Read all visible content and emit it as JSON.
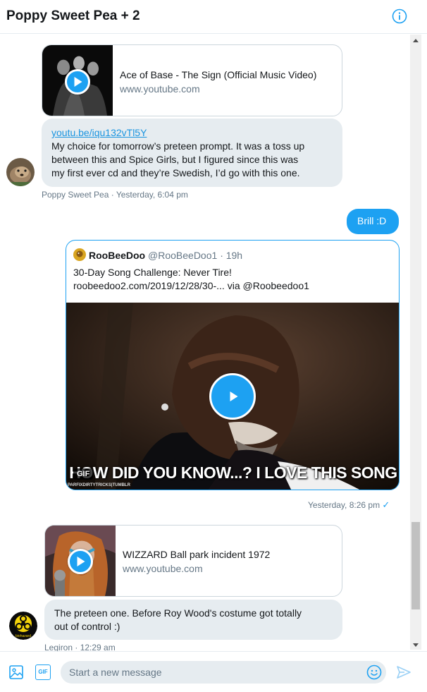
{
  "header": {
    "title": "Poppy Sweet Pea + 2"
  },
  "messages": {
    "m1_card": {
      "title": "Ace of Base - The Sign (Official Music Video)",
      "url": "www.youtube.com"
    },
    "m1": {
      "link": "youtu.be/iqu132vTl5Y",
      "lines": [
        "My choice for tomorrow’s preteen prompt. It was a toss up",
        "between this and Spice Girls, but I figured since this was",
        "my first ever cd and they’re Swedish, I’d go with this one."
      ],
      "meta": "Poppy Sweet Pea · Yesterday, 6:04 pm"
    },
    "m2": {
      "text": "Brill :D"
    },
    "tweet": {
      "name": "RooBeeDoo",
      "handle": "@RooBeeDoo1",
      "time": "· 19h",
      "line1": "30-Day Song Challenge: Never Tire!",
      "line2": "roobeedoo2.com/2019/12/28/30-... via @Roobeedoo1",
      "caption": "HOW DID YOU KNOW...? I LOVE THIS SONG",
      "gif_label": "GIF",
      "watermark": "PARFIXDIRTYTRICKS|TUMBLR",
      "meta": "Yesterday, 8:26 pm",
      "read_mark": "✓"
    },
    "m3_card": {
      "title": "WIZZARD Ball park incident 1972",
      "url": "www.youtube.com"
    },
    "m3": {
      "text_line1": "The preteen one. Before Roy Wood's costume got totally",
      "text_line2": "out of control :)",
      "meta": "Legiron · 12:29 am",
      "avatar_text": "biohazard"
    }
  },
  "composer": {
    "placeholder": "Start a new message",
    "gif_label": "GIF"
  },
  "colors": {
    "accent": "#1da1f2",
    "bubble_in": "#e6ecf0",
    "meta_text": "#657786"
  },
  "icons": [
    "info-icon",
    "play-icon",
    "image-icon",
    "gif-icon",
    "emoji-icon",
    "send-icon"
  ]
}
